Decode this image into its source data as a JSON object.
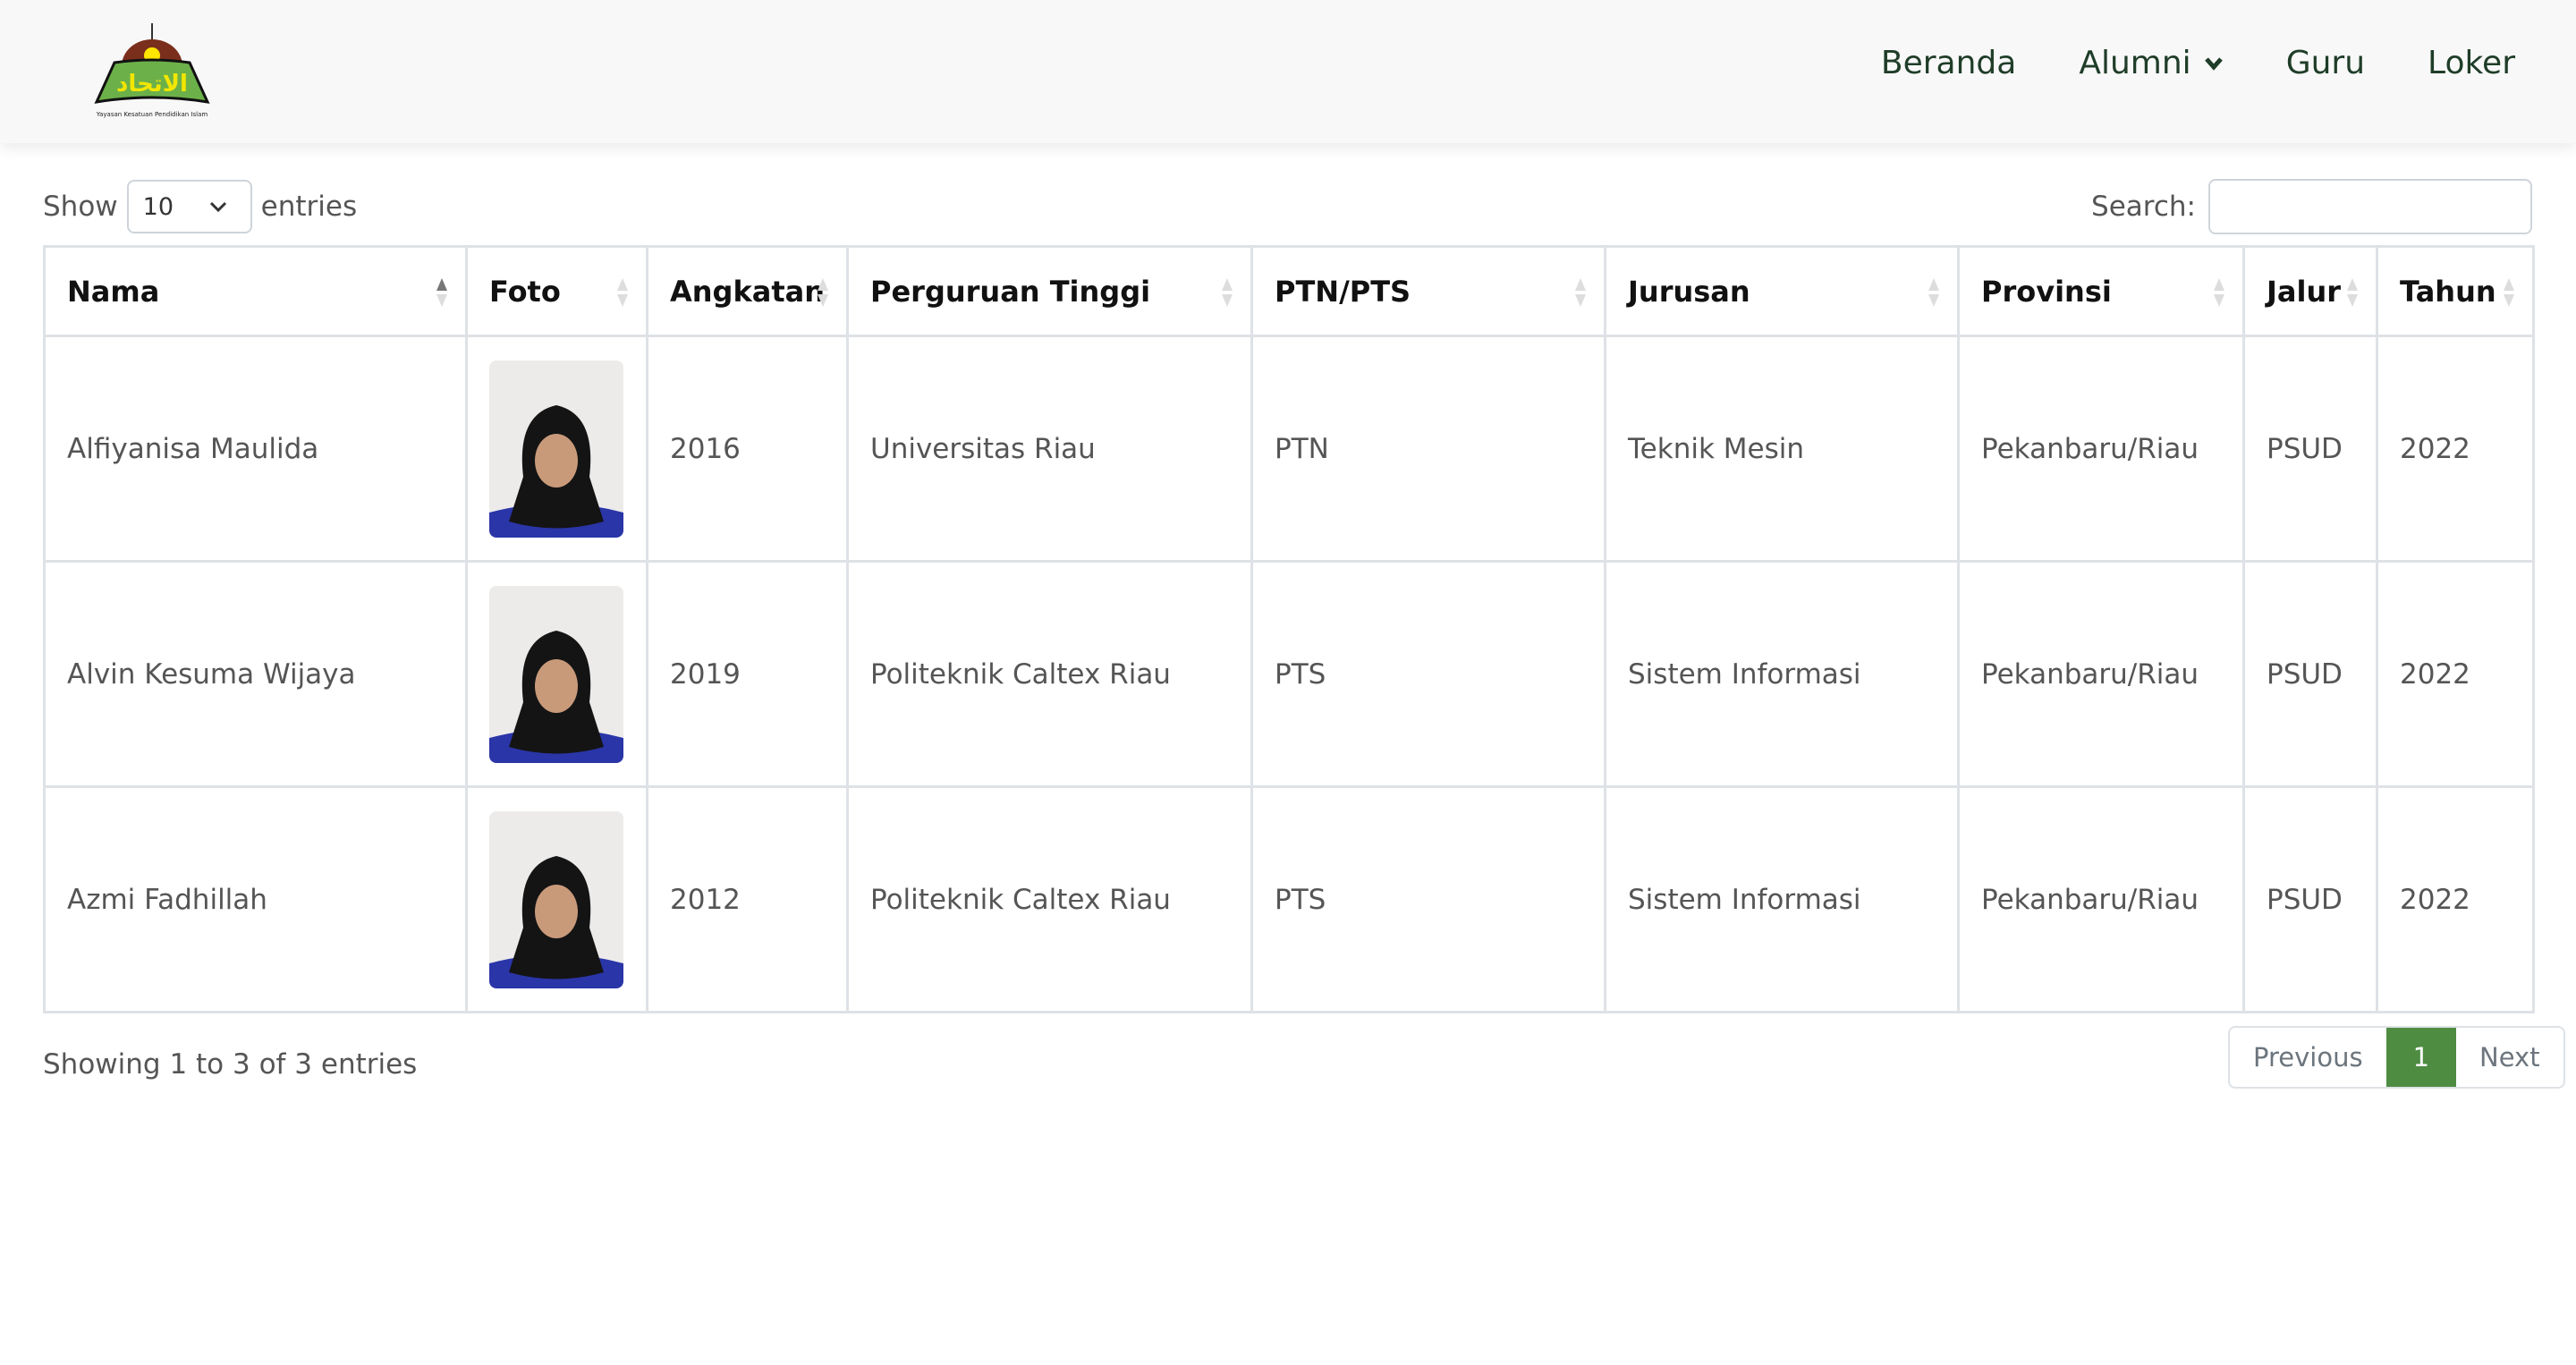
{
  "nav": {
    "logo_text": "Yayasan Kesatuan Pendidikan Islam",
    "items": [
      {
        "label": "Beranda"
      },
      {
        "label": "Alumni",
        "dropdown": true
      },
      {
        "label": "Guru"
      },
      {
        "label": "Loker"
      }
    ],
    "text_color": "#1f3d28"
  },
  "controls": {
    "show_label": "Show",
    "entries_value": "10",
    "entries_label": "entries",
    "search_label": "Search:",
    "search_value": ""
  },
  "table": {
    "columns": [
      "Nama",
      "Foto",
      "Angkatan",
      "Perguruan Tinggi",
      "PTN/PTS",
      "Jurusan",
      "Provinsi",
      "Jalur",
      "Tahun"
    ],
    "sorted_column": "Nama",
    "sort_direction": "asc",
    "rows": [
      {
        "nama": "Alfiyanisa Maulida",
        "angkatan": "2016",
        "pt": "Universitas Riau",
        "jenis": "PTN",
        "jurusan": "Teknik Mesin",
        "provinsi": "Pekanbaru/Riau",
        "jalur": "PSUD",
        "tahun": "2022"
      },
      {
        "nama": "Alvin Kesuma Wijaya",
        "angkatan": "2019",
        "pt": "Politeknik Caltex Riau",
        "jenis": "PTS",
        "jurusan": "Sistem Informasi",
        "provinsi": "Pekanbaru/Riau",
        "jalur": "PSUD",
        "tahun": "2022"
      },
      {
        "nama": "Azmi Fadhillah",
        "angkatan": "2012",
        "pt": "Politeknik Caltex Riau",
        "jenis": "PTS",
        "jurusan": "Sistem Informasi",
        "provinsi": "Pekanbaru/Riau",
        "jalur": "PSUD",
        "tahun": "2022"
      }
    ]
  },
  "footer": {
    "info": "Showing 1 to 3 of 3 entries",
    "previous": "Previous",
    "current_page": "1",
    "next": "Next",
    "accent": "#4e8c42"
  }
}
